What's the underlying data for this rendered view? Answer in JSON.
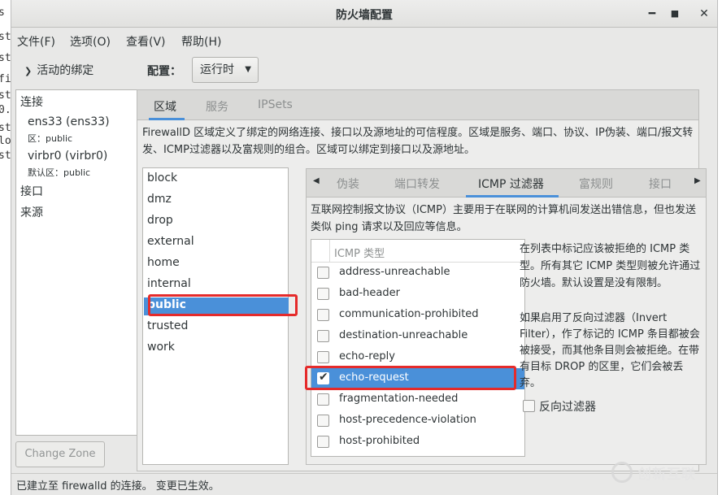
{
  "window": {
    "title": "防火墙配置"
  },
  "window_controls": {
    "minimize": "━",
    "maximize": "■",
    "close": "✕"
  },
  "menubar": [
    "文件(F)",
    "选项(O)",
    "查看(V)",
    "帮助(H)"
  ],
  "bindings": {
    "header": "活动的绑定",
    "connections_label": "连接",
    "connections": [
      {
        "name": "ens33 (ens33)",
        "zone": "区：public"
      },
      {
        "name": "virbr0 (virbr0)",
        "zone": "默认区：public"
      }
    ],
    "interfaces_label": "接口",
    "sources_label": "来源",
    "change_zone_button": "Change Zone"
  },
  "config": {
    "label": "配置：",
    "value": "运行时"
  },
  "top_tabs": [
    {
      "label": "区域",
      "active": true
    },
    {
      "label": "服务",
      "active": false
    },
    {
      "label": "IPSets",
      "active": false
    }
  ],
  "zone_description": "FirewallD 区域定义了绑定的网络连接、接口以及源地址的可信程度。区域是服务、端口、协议、IP伪装、端口/报文转发、ICMP过滤器以及富规则的组合。区域可以绑定到接口以及源地址。",
  "zones": [
    "block",
    "dmz",
    "drop",
    "external",
    "home",
    "internal",
    "public",
    "trusted",
    "work"
  ],
  "selected_zone": "public",
  "zone_tabs": [
    {
      "label": "伪装",
      "active": false
    },
    {
      "label": "端口转发",
      "active": false
    },
    {
      "label": "ICMP 过滤器",
      "active": true
    },
    {
      "label": "富规则",
      "active": false
    },
    {
      "label": "接口",
      "active": false
    }
  ],
  "icmp": {
    "description": "互联网控制报文协议（ICMP）主要用于在联网的计算机间发送出错信息，但也发送类似 ping 请求以及回应等信息。",
    "column_header": "ICMP 类型",
    "types": [
      {
        "name": "address-unreachable",
        "checked": false
      },
      {
        "name": "bad-header",
        "checked": false
      },
      {
        "name": "communication-prohibited",
        "checked": false
      },
      {
        "name": "destination-unreachable",
        "checked": false
      },
      {
        "name": "echo-reply",
        "checked": false
      },
      {
        "name": "echo-request",
        "checked": true
      },
      {
        "name": "fragmentation-needed",
        "checked": false
      },
      {
        "name": "host-precedence-violation",
        "checked": false
      },
      {
        "name": "host-prohibited",
        "checked": false
      }
    ],
    "help_text_1": "在列表中标记应该被拒绝的 ICMP 类型。所有其它 ICMP 类型则被允许通过防火墙。默认设置是没有限制。",
    "help_text_2": "如果启用了反向过滤器（Invert Filter），作了标记的 ICMP 条目都被会被接受，而其他条目则会被拒绝。在带有目标 DROP 的区里，它们会被丢弃。",
    "invert_filter_label": "反向过滤器",
    "invert_filter_checked": false
  },
  "status": "已建立至 firewalld 的连接。 变更已生效。",
  "watermark": "创新互联",
  "background_terminal": [
    "s",
    "st",
    "st",
    "fi",
    "st",
    "0.",
    "st",
    "lo",
    "st"
  ],
  "colors": {
    "selection": "#4a90d9",
    "highlight_box": "#e52b2b"
  }
}
